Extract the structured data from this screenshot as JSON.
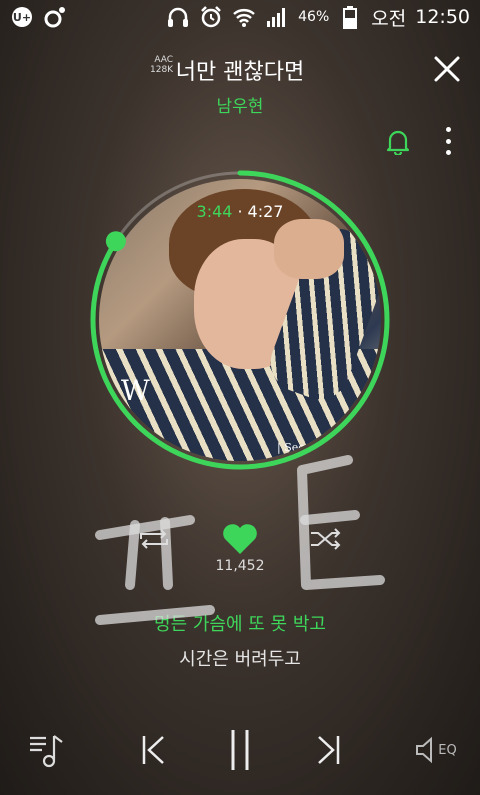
{
  "statusbar": {
    "battery_percent": "46%",
    "ampm": "오전",
    "clock": "12:50",
    "icons": [
      "uplus-icon",
      "music-app-icon",
      "headset-icon",
      "alarm-icon",
      "wifi-icon",
      "signal-icon",
      "battery-icon"
    ]
  },
  "header": {
    "quality_top": "AAC",
    "quality_bottom": "128K",
    "song_title": "너만 괜찮다면",
    "artist": "남우현"
  },
  "player": {
    "current_time": "3:44",
    "separator": "·",
    "total_time": "4:27",
    "progress": 0.84,
    "like_count": "11,452",
    "album_mark": "W",
    "album_text": "| Seco"
  },
  "lyrics": {
    "current_line": "멍든 가슴에 또 못 박고",
    "next_line": "시간은 버려두고"
  },
  "controls": {
    "eq_label": "EQ"
  },
  "colors": {
    "accent": "#3ed65a",
    "text": "#ffffff"
  }
}
